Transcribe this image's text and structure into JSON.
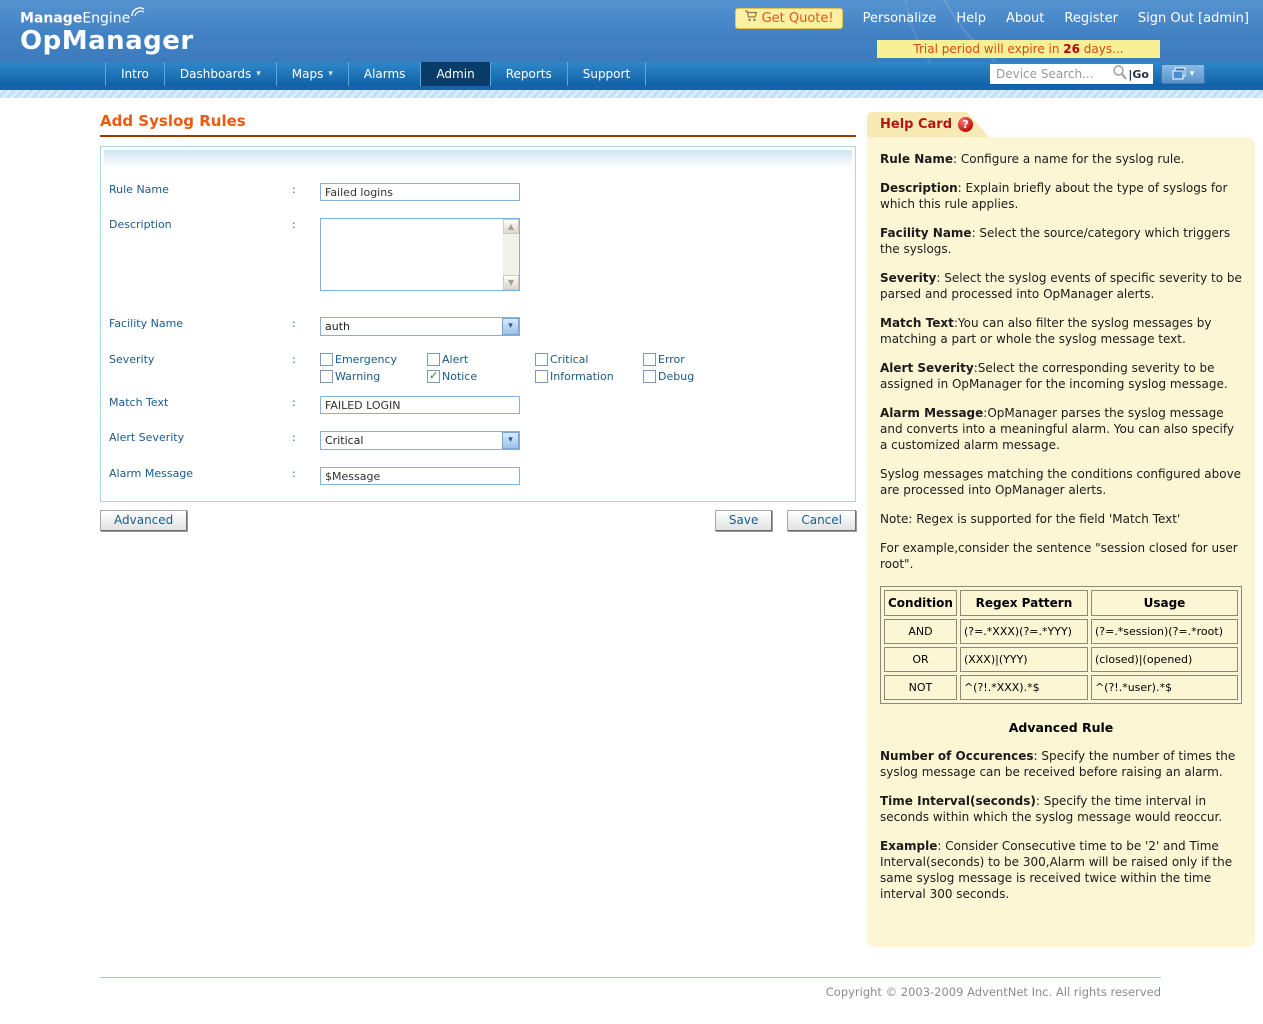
{
  "header": {
    "brand_bold": "Manage",
    "brand_light": "Engine",
    "brand_main": "OpManager",
    "get_quote_label": "Get Quote!",
    "links": [
      "Personalize",
      "Help",
      "About",
      "Register",
      "Sign Out [admin]"
    ],
    "trial_prefix": "Trial period will expire in ",
    "trial_days": "26",
    "trial_suffix": " days..."
  },
  "nav": {
    "tabs": [
      {
        "label": "Intro"
      },
      {
        "label": "Dashboards"
      },
      {
        "label": "Maps"
      },
      {
        "label": "Alarms"
      },
      {
        "label": "Admin"
      },
      {
        "label": "Reports"
      },
      {
        "label": "Support"
      }
    ],
    "search_placeholder": "Device Search...",
    "go_label": "|Go"
  },
  "icons": {
    "chevron_down": "▾",
    "scroll_up": "▲",
    "scroll_down": "▼",
    "question_mark": "?"
  },
  "form": {
    "title": "Add Syslog Rules",
    "colon": ":",
    "rule_name": {
      "label": "Rule Name",
      "value": "Failed logins"
    },
    "description": {
      "label": "Description",
      "value": ""
    },
    "facility_name": {
      "label": "Facility Name",
      "value": "auth"
    },
    "severity_label": "Severity",
    "severity_options": [
      {
        "label": "Emergency",
        "checked": false
      },
      {
        "label": "Alert",
        "checked": false
      },
      {
        "label": "Critical",
        "checked": false
      },
      {
        "label": "Error",
        "checked": false
      },
      {
        "label": "Warning",
        "checked": false
      },
      {
        "label": "Notice",
        "checked": true
      },
      {
        "label": "Information",
        "checked": false
      },
      {
        "label": "Debug",
        "checked": false
      }
    ],
    "match_text": {
      "label": "Match Text",
      "value": "FAILED LOGIN"
    },
    "alert_severity": {
      "label": "Alert Severity",
      "value": "Critical"
    },
    "alarm_message": {
      "label": "Alarm Message",
      "value": "$Message"
    },
    "buttons": {
      "advanced": "Advanced",
      "save": "Save",
      "cancel": "Cancel"
    }
  },
  "help_card": {
    "title": "Help Card",
    "paragraphs": [
      {
        "bold": "Rule Name",
        "text": ": Configure a name for the syslog rule."
      },
      {
        "bold": "Description",
        "text": ": Explain briefly about the type of syslogs for which this rule applies."
      },
      {
        "bold": "Facility Name",
        "text": ": Select the source/category which triggers the syslogs."
      },
      {
        "bold": "Severity",
        "text": ": Select the syslog events of specific severity to be parsed and processed into OpManager alerts."
      },
      {
        "bold": "Match Text",
        "text": ":You can also filter the syslog messages by matching a part or whole the syslog message text."
      },
      {
        "bold": "Alert Severity",
        "text": ":Select the corresponding severity to be assigned in OpManager for the incoming syslog message."
      },
      {
        "bold": "Alarm Message",
        "text": ":OpManager parses the syslog message and converts into a meaningful alarm. You can also specify a customized alarm message."
      },
      {
        "bold": "",
        "text": "Syslog messages matching the conditions configured above are processed into OpManager alerts."
      },
      {
        "bold": "",
        "text": "Note: Regex is supported for the field 'Match Text'"
      },
      {
        "bold": "",
        "text": "For example,consider the sentence \"session closed for user root\"."
      }
    ],
    "table": {
      "headers": [
        "Condition",
        "Regex Pattern",
        "Usage"
      ],
      "rows": [
        [
          "AND",
          "(?=.*XXX)(?=.*YYY)",
          "(?=.*session)(?=.*root)"
        ],
        [
          "OR",
          "(XXX)|(YYY)",
          "(closed)|(opened)"
        ],
        [
          "NOT",
          "^(?!.*XXX).*$",
          "^(?!.*user).*$"
        ]
      ]
    },
    "advanced_heading": "Advanced Rule",
    "advanced_paragraphs": [
      {
        "bold": "Number of Occurences",
        "text": ": Specify the number of times the syslog message can be received before raising an alarm."
      },
      {
        "bold": "Time Interval(seconds)",
        "text": ": Specify the time interval in seconds within which the syslog message would reoccur."
      },
      {
        "bold": "Example",
        "text": ": Consider Consecutive time to be '2' and Time Interval(seconds) to be 300,Alarm will be raised only if the same syslog message is received twice within the time interval 300 seconds."
      }
    ]
  },
  "footer": {
    "copyright": "Copyright © 2003-2009 AdventNet Inc. All rights reserved"
  }
}
